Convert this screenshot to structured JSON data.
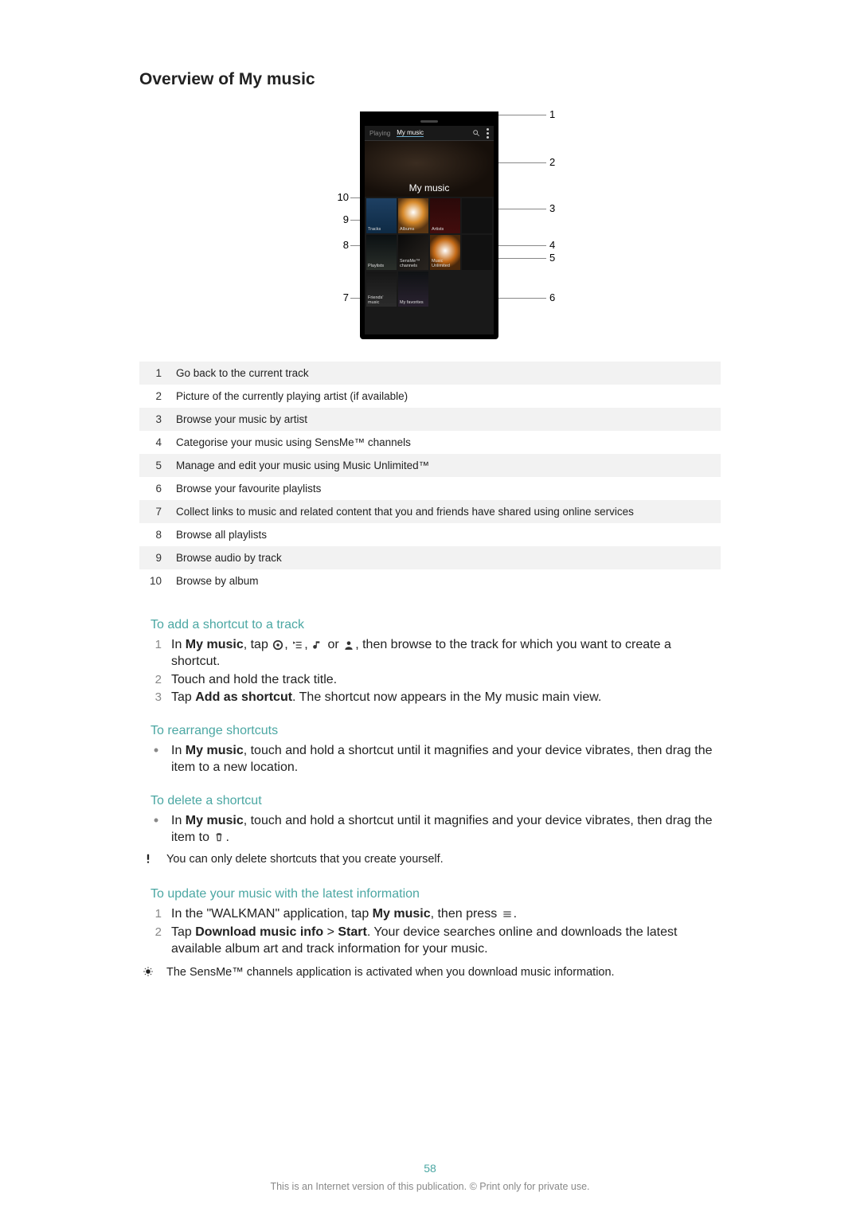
{
  "heading": "Overview of My music",
  "screen": {
    "tab_playing": "Playing",
    "tab_mymusic": "My music",
    "big_label": "My music",
    "tiles": {
      "tracks": "Tracks",
      "albums": "Albums",
      "artists": "Artists",
      "playlists": "Playlists",
      "sensme": "SensMe™ channels",
      "music_unlimited": "Music Unlimited",
      "friends": "Friends' music",
      "favorites": "My favorites"
    }
  },
  "callouts": {
    "1": "1",
    "2": "2",
    "3": "3",
    "4": "4",
    "5": "5",
    "6": "6",
    "7": "7",
    "8": "8",
    "9": "9",
    "10": "10"
  },
  "legend": [
    {
      "n": "1",
      "t": "Go back to the current track"
    },
    {
      "n": "2",
      "t": "Picture of the currently playing artist (if available)"
    },
    {
      "n": "3",
      "t": "Browse your music by artist"
    },
    {
      "n": "4",
      "t": "Categorise your music using SensMe™ channels"
    },
    {
      "n": "5",
      "t": "Manage and edit your music using Music Unlimited™"
    },
    {
      "n": "6",
      "t": "Browse your favourite playlists"
    },
    {
      "n": "7",
      "t": "Collect links to music and related content that you and friends have shared using online services"
    },
    {
      "n": "8",
      "t": "Browse all playlists"
    },
    {
      "n": "9",
      "t": "Browse audio by track"
    },
    {
      "n": "10",
      "t": "Browse by album"
    }
  ],
  "sec1": {
    "title": "To add a shortcut to a track",
    "step1_a": "In ",
    "step1_b": "My music",
    "step1_c": ", tap ",
    "step1_d": ", then browse to the track for which you want to create a shortcut.",
    "step2": "Touch and hold the track title.",
    "step3_a": "Tap ",
    "step3_b": "Add as shortcut",
    "step3_c": ". The shortcut now appears in the My music main view."
  },
  "sec2": {
    "title": "To rearrange shortcuts",
    "p1_a": "In ",
    "p1_b": "My music",
    "p1_c": ", touch and hold a shortcut until it magnifies and your device vibrates, then drag the item to a new location."
  },
  "sec3": {
    "title": "To delete a shortcut",
    "p1_a": "In ",
    "p1_b": "My music",
    "p1_c": ", touch and hold a shortcut until it magnifies and your device vibrates, then drag the item to ",
    "p1_d": ".",
    "note": "You can only delete shortcuts that you create yourself."
  },
  "sec4": {
    "title": "To update your music with the latest information",
    "s1_a": "In the \"WALKMAN\" application, tap ",
    "s1_b": "My music",
    "s1_c": ", then press ",
    "s1_d": ".",
    "s2_a": "Tap ",
    "s2_b": "Download music info",
    "s2_c": " > ",
    "s2_d": "Start",
    "s2_e": ". Your device searches online and downloads the latest available album art and track information for your music.",
    "tip": "The SensMe™ channels application is activated when you download music information."
  },
  "page_number": "58",
  "footer": "This is an Internet version of this publication. © Print only for private use."
}
